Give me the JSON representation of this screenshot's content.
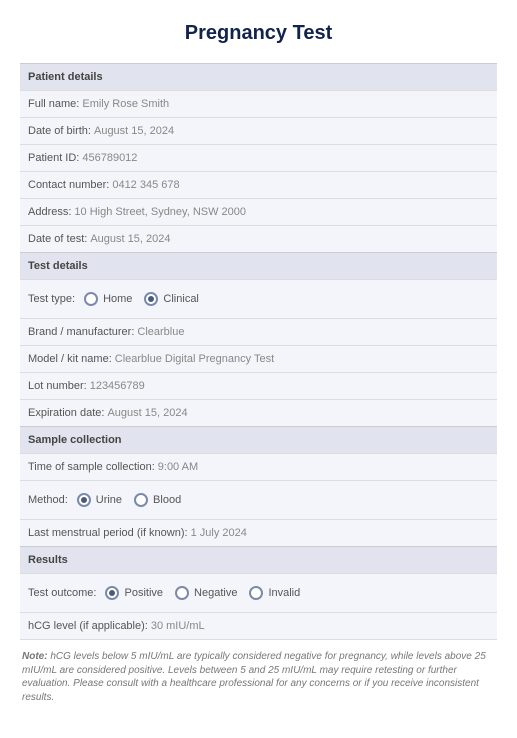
{
  "title": "Pregnancy Test",
  "sections": {
    "patient": {
      "header": "Patient details",
      "full_name_label": "Full name:",
      "full_name_value": "Emily Rose Smith",
      "dob_label": "Date of birth:",
      "dob_value": "August 15, 2024",
      "pid_label": "Patient ID:",
      "pid_value": "456789012",
      "contact_label": "Contact number:",
      "contact_value": "0412 345 678",
      "address_label": "Address:",
      "address_value": "10 High Street, Sydney, NSW 2000",
      "test_date_label": "Date of test:",
      "test_date_value": "August 15, 2024"
    },
    "test": {
      "header": "Test details",
      "type_label": "Test type:",
      "type_home": "Home",
      "type_clinical": "Clinical",
      "brand_label": "Brand / manufacturer:",
      "brand_value": "Clearblue",
      "model_label": "Model / kit name:",
      "model_value": "Clearblue Digital Pregnancy Test",
      "lot_label": "Lot number:",
      "lot_value": "123456789",
      "exp_label": "Expiration date:",
      "exp_value": "August 15, 2024"
    },
    "sample": {
      "header": "Sample collection",
      "time_label": "Time of sample collection:",
      "time_value": "9:00 AM",
      "method_label": "Method:",
      "method_urine": "Urine",
      "method_blood": "Blood",
      "lmp_label": "Last menstrual period (if known):",
      "lmp_value": "1 July 2024"
    },
    "results": {
      "header": "Results",
      "outcome_label": "Test outcome:",
      "outcome_positive": "Positive",
      "outcome_negative": "Negative",
      "outcome_invalid": "Invalid",
      "hcg_label": "hCG level (if applicable):",
      "hcg_value": "30 mIU/mL"
    }
  },
  "note_bold": "Note:",
  "note_text": " hCG levels below 5 mIU/mL are typically considered negative for pregnancy, while levels above 25 mIU/mL are considered positive. Levels between 5 and 25 mIU/mL may require retesting or further evaluation. Please consult with a healthcare professional for any concerns or if you receive inconsistent results."
}
